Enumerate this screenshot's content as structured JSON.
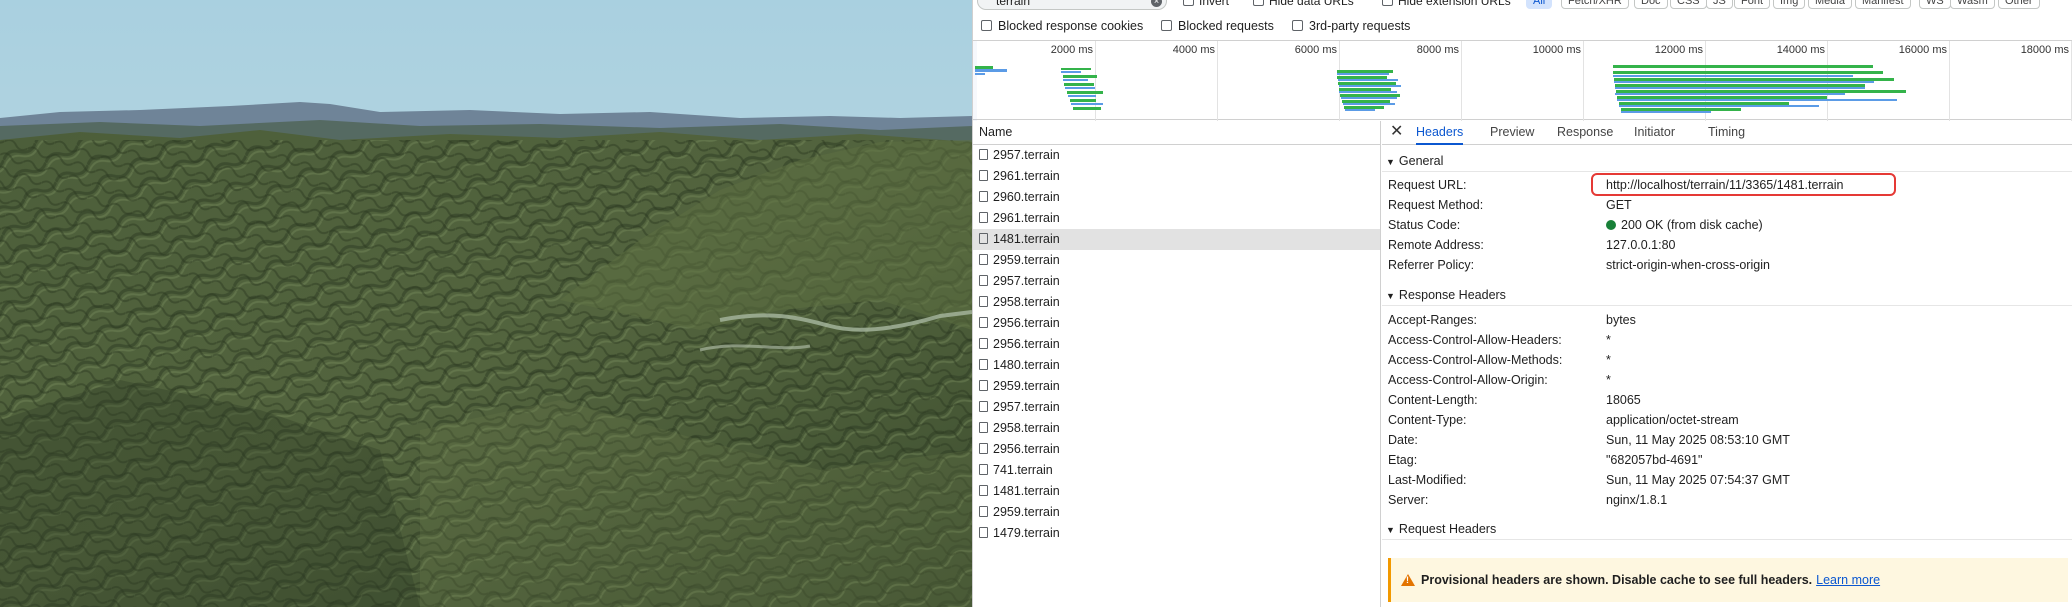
{
  "filter_bar": {
    "search_value": "terrain",
    "invert_label": "Invert",
    "hide_data_urls_label": "Hide data URLs",
    "hide_extension_urls_label": "Hide extension URLs",
    "type_filters": [
      "All",
      "Fetch/XHR",
      "Doc",
      "CSS",
      "JS",
      "Font",
      "Img",
      "Media",
      "Manifest",
      "WS",
      "Wasm",
      "Other"
    ],
    "blocked_response_cookies_label": "Blocked response cookies",
    "blocked_requests_label": "Blocked requests",
    "third_party_label": "3rd-party requests"
  },
  "overview": {
    "ticks": [
      "2000 ms",
      "4000 ms",
      "6000 ms",
      "8000 ms",
      "10000 ms",
      "12000 ms",
      "14000 ms",
      "16000 ms",
      "18000 ms"
    ]
  },
  "request_list": {
    "header": "Name",
    "rows": [
      "2957.terrain",
      "2961.terrain",
      "2960.terrain",
      "2961.terrain",
      "1481.terrain",
      "2959.terrain",
      "2957.terrain",
      "2958.terrain",
      "2956.terrain",
      "2956.terrain",
      "1480.terrain",
      "2959.terrain",
      "2957.terrain",
      "2958.terrain",
      "2956.terrain",
      "741.terrain",
      "1481.terrain",
      "2959.terrain",
      "1479.terrain"
    ],
    "selected_index": 4
  },
  "details": {
    "tabs": [
      "Headers",
      "Preview",
      "Response",
      "Initiator",
      "Timing"
    ],
    "active_tab": "Headers",
    "general": {
      "title": "General",
      "request_url_key": "Request URL:",
      "request_url": "http://localhost/terrain/11/3365/1481.terrain",
      "request_method_key": "Request Method:",
      "request_method": "GET",
      "status_code_key": "Status Code:",
      "status_code": "200 OK (from disk cache)",
      "remote_address_key": "Remote Address:",
      "remote_address": "127.0.0.1:80",
      "referrer_policy_key": "Referrer Policy:",
      "referrer_policy": "strict-origin-when-cross-origin"
    },
    "response_headers": {
      "title": "Response Headers",
      "items": [
        {
          "key": "Accept-Ranges:",
          "value": "bytes"
        },
        {
          "key": "Access-Control-Allow-Headers:",
          "value": "*"
        },
        {
          "key": "Access-Control-Allow-Methods:",
          "value": "*"
        },
        {
          "key": "Access-Control-Allow-Origin:",
          "value": "*"
        },
        {
          "key": "Content-Length:",
          "value": "18065"
        },
        {
          "key": "Content-Type:",
          "value": "application/octet-stream"
        },
        {
          "key": "Date:",
          "value": "Sun, 11 May 2025 08:53:10 GMT"
        },
        {
          "key": "Etag:",
          "value": "\"682057bd-4691\""
        },
        {
          "key": "Last-Modified:",
          "value": "Sun, 11 May 2025 07:54:37 GMT"
        },
        {
          "key": "Server:",
          "value": "nginx/1.8.1"
        }
      ]
    },
    "request_headers": {
      "title": "Request Headers",
      "warning": "Provisional headers are shown. Disable cache to see full headers.",
      "learn_more": "Learn more"
    }
  },
  "colors": {
    "accent": "#0b57d0",
    "status_ok": "#188038",
    "highlight": "#e53935",
    "warning": "#e37400"
  }
}
